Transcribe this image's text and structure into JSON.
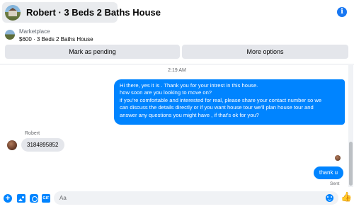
{
  "header": {
    "title": "Robert · 3 Beds 2 Baths House",
    "info_icon": "info-icon"
  },
  "marketplace": {
    "label": "Marketplace",
    "listing": "$600 · 3 Beds 2 Baths House",
    "buttons": {
      "mark_pending": "Mark as pending",
      "more_options": "More options"
    }
  },
  "conversation": {
    "timestamp": "2:19 AM",
    "outgoing_message_lines": [
      "Hi there, yes it is . Thank you for your intrest in this house.",
      "how soon are you looking to move on?",
      "if you're comfortable and interested for real, please share your contact number so we",
      "can discuss the details directly or if you  want house tour we'll plan house tour and",
      "answer any questions you might have , if that's ok for you?"
    ],
    "sender_name": "Robert",
    "incoming_message": "3184895852",
    "reply_message": "thank u",
    "status": "Sent"
  },
  "composer": {
    "placeholder": "Aa",
    "value": "",
    "icons": [
      "plus-icon",
      "photo-icon",
      "sticker-icon",
      "gif-icon",
      "emoji-icon",
      "like-icon"
    ],
    "gif_label": "GIF"
  },
  "colors": {
    "accent": "#0084ff",
    "bubble_in": "#e4e6eb",
    "button_bg": "#e4e6eb"
  }
}
